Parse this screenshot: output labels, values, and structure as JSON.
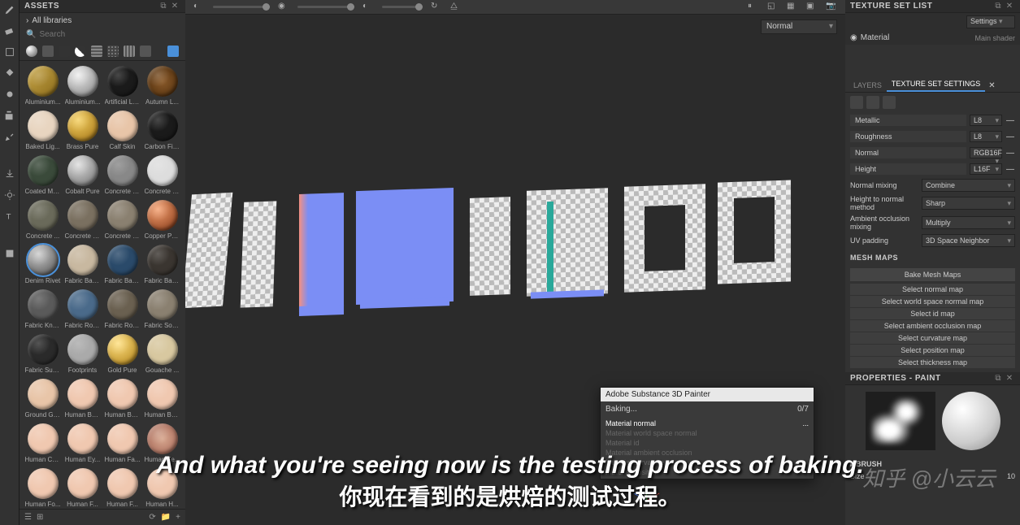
{
  "panels": {
    "assets": {
      "title": "ASSETS",
      "all_libs": "All libraries",
      "search_ph": "Search"
    },
    "texset_list": {
      "title": "TEXTURE SET LIST",
      "settings": "Settings",
      "material": "Material",
      "shader": "Main shader"
    },
    "props": {
      "title": "PROPERTIES - PAINT"
    }
  },
  "viewport": {
    "mode": "Normal"
  },
  "materials": [
    {
      "n": "Aluminium...",
      "c": "linear-gradient(135deg,#c9a84a,#8a6a1a)"
    },
    {
      "n": "Aluminium...",
      "c": "radial-gradient(circle at 35% 30%,#eee,#777)"
    },
    {
      "n": "Artificial Le...",
      "c": "#1a1a1a"
    },
    {
      "n": "Autumn L...",
      "c": "radial-gradient(circle,#8a5a2a,#4a2a0a)"
    },
    {
      "n": "Baked Lig...",
      "c": "#e8d5c0"
    },
    {
      "n": "Brass Pure",
      "c": "radial-gradient(circle at 35% 30%,#f5d060,#9a6a10)"
    },
    {
      "n": "Calf Skin",
      "c": "#e8c5a8"
    },
    {
      "n": "Carbon Fiber",
      "c": "#1a1a1a"
    },
    {
      "n": "Coated Me...",
      "c": "#3a4a3a"
    },
    {
      "n": "Cobalt Pure",
      "c": "radial-gradient(circle at 35% 30%,#ddd,#666)"
    },
    {
      "n": "Concrete B...",
      "c": "#888"
    },
    {
      "n": "Concrete C...",
      "c": "#ddd"
    },
    {
      "n": "Concrete ...",
      "c": "#6a6a5a"
    },
    {
      "n": "Concrete S...",
      "c": "#7a7060"
    },
    {
      "n": "Concrete S...",
      "c": "#8a8070"
    },
    {
      "n": "Copper Pure",
      "c": "radial-gradient(circle at 35% 30%,#f5a070,#7a3010)"
    },
    {
      "n": "Denim Rivet",
      "c": "radial-gradient(circle at 35% 30%,#ccc,#444)",
      "sel": true
    },
    {
      "n": "Fabric Bas...",
      "c": "#c8b8a0"
    },
    {
      "n": "Fabric Bas...",
      "c": "#2a4a6a"
    },
    {
      "n": "Fabric Bas...",
      "c": "#3a3530"
    },
    {
      "n": "Fabric Knit...",
      "c": "#5a5a5a"
    },
    {
      "n": "Fabric Rou...",
      "c": "#4a6a8a"
    },
    {
      "n": "Fabric Rou...",
      "c": "#6a6050"
    },
    {
      "n": "Fabric Soft...",
      "c": "#8a8070"
    },
    {
      "n": "Fabric Suit...",
      "c": "#2a2a2a"
    },
    {
      "n": "Footprints",
      "c": "#aaa"
    },
    {
      "n": "Gold Pure",
      "c": "radial-gradient(circle at 35% 30%,#ffe080,#aa7a10)"
    },
    {
      "n": "Gouache ...",
      "c": "#d8c8a0"
    },
    {
      "n": "Ground Gr...",
      "c": "#e8c5a8"
    },
    {
      "n": "Human Ba...",
      "c": "#f0c8b0"
    },
    {
      "n": "Human Be...",
      "c": "#f0c8b0"
    },
    {
      "n": "Human Bu...",
      "c": "#f0c8b0"
    },
    {
      "n": "Human Ch...",
      "c": "#f0c8b0"
    },
    {
      "n": "Human Ey...",
      "c": "#f0c8b0"
    },
    {
      "n": "Human Fa...",
      "c": "#f0c8b0"
    },
    {
      "n": "Human Fe...",
      "c": "radial-gradient(ellipse,#d8a890,#a06050)"
    },
    {
      "n": "Human Fo...",
      "c": "#f0c8b0"
    },
    {
      "n": "Human F...",
      "c": "#f0c8b0"
    },
    {
      "n": "Human F...",
      "c": "#f0c8b0"
    },
    {
      "n": "Human H...",
      "c": "#f0c8b0"
    }
  ],
  "baking": {
    "title": "Adobe Substance 3D Painter",
    "status": "Baking...",
    "progress": "0/7",
    "current": "Material normal",
    "dots": "...",
    "pending": [
      "Material world space normal",
      "Material id",
      "Material ambient occlusion",
      "Material curvature",
      "Material position"
    ]
  },
  "right_tabs": {
    "layers": "LAYERS",
    "tss": "TEXTURE SET SETTINGS"
  },
  "channels": [
    {
      "n": "Metallic",
      "f": "L8"
    },
    {
      "n": "Roughness",
      "f": "L8"
    },
    {
      "n": "Normal",
      "f": "RGB16F"
    },
    {
      "n": "Height",
      "f": "L16F"
    }
  ],
  "settings": [
    {
      "n": "Normal mixing",
      "v": "Combine"
    },
    {
      "n": "Height to normal method",
      "v": "Sharp"
    },
    {
      "n": "Ambient occlusion mixing",
      "v": "Multiply"
    },
    {
      "n": "UV padding",
      "v": "3D Space Neighbor"
    }
  ],
  "mesh_maps": {
    "title": "MESH MAPS",
    "bake": "Bake Mesh Maps",
    "maps": [
      "Select normal map",
      "Select world space normal map",
      "Select id map",
      "Select ambient occlusion map",
      "Select curvature map",
      "Select position map",
      "Select thickness map"
    ]
  },
  "brush": {
    "title": "BRUSH",
    "size_lbl": "Size",
    "size_v": "10"
  },
  "subtitles": {
    "en": "And what you're seeing now is the testing process of baking.",
    "cn": "你现在看到的是烘焙的测试过程。"
  },
  "watermark": "知乎 @小云云"
}
